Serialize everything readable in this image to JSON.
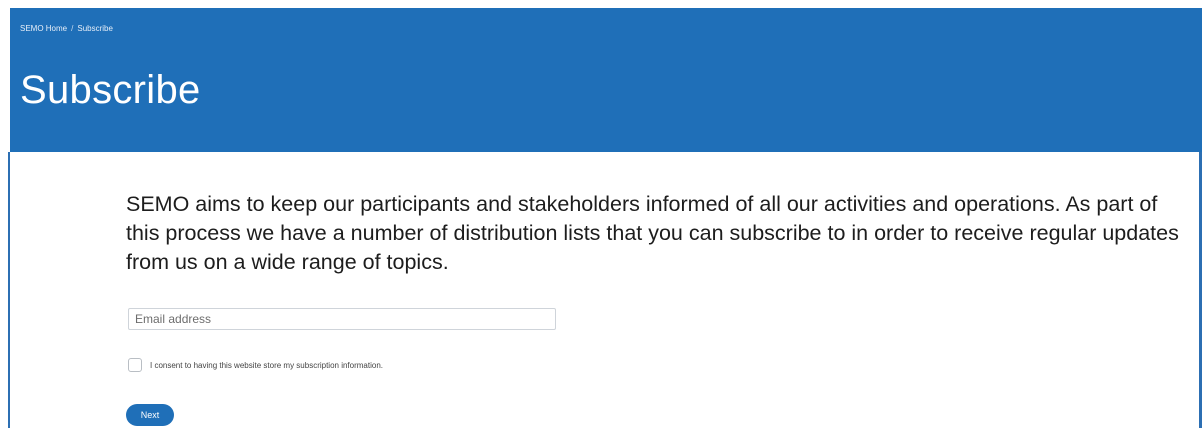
{
  "breadcrumb": {
    "home_label": "SEMO Home",
    "separator": "/",
    "current_label": "Subscribe"
  },
  "header": {
    "title": "Subscribe"
  },
  "main": {
    "intro_text": "SEMO aims to keep our participants and stakeholders informed of all our activities and operations. As part of this process we have a number of distribution lists that you can subscribe to in order to receive regular updates from us on a wide range of topics.",
    "email": {
      "placeholder": "Email address",
      "value": ""
    },
    "consent": {
      "label": "I consent to having this website store my subscription information.",
      "checked": false
    },
    "next_label": "Next"
  },
  "colors": {
    "brand_blue": "#1f6fb8",
    "text": "#1d1d1d"
  }
}
